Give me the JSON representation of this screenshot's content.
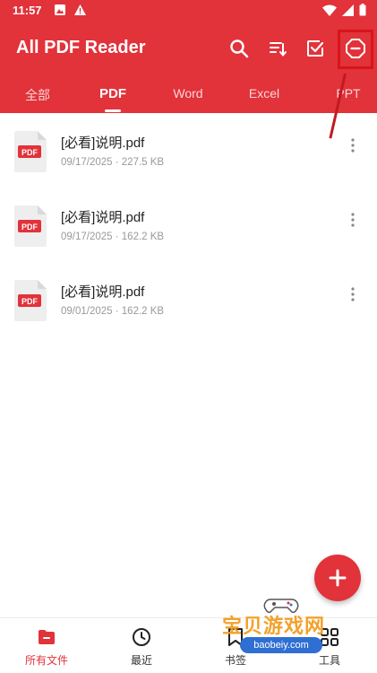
{
  "status_bar": {
    "time": "11:57"
  },
  "app": {
    "title": "All PDF Reader"
  },
  "tabs": [
    {
      "label": "全部"
    },
    {
      "label": "PDF"
    },
    {
      "label": "Word"
    },
    {
      "label": "Excel"
    },
    {
      "label": "PPT"
    }
  ],
  "files": [
    {
      "icon_text": "PDF",
      "name": "[必看]说明.pdf",
      "meta": "09/17/2025 · 227.5 KB"
    },
    {
      "icon_text": "PDF",
      "name": "[必看]说明.pdf",
      "meta": "09/17/2025 · 162.2 KB"
    },
    {
      "icon_text": "PDF",
      "name": "[必看]说明.pdf",
      "meta": "09/01/2025 · 162.2 KB"
    }
  ],
  "bottom_nav": [
    {
      "label": "所有文件",
      "icon": "folder-icon",
      "active": true
    },
    {
      "label": "最近",
      "icon": "clock-icon",
      "active": false
    },
    {
      "label": "书签",
      "icon": "bookmark-icon",
      "active": false
    },
    {
      "label": "工具",
      "icon": "grid-icon",
      "active": false
    }
  ],
  "watermark": {
    "text": "宝贝游戏网",
    "url": "baobeiy.com"
  },
  "colors": {
    "accent": "#e2323a",
    "highlight": "#d8141c"
  }
}
